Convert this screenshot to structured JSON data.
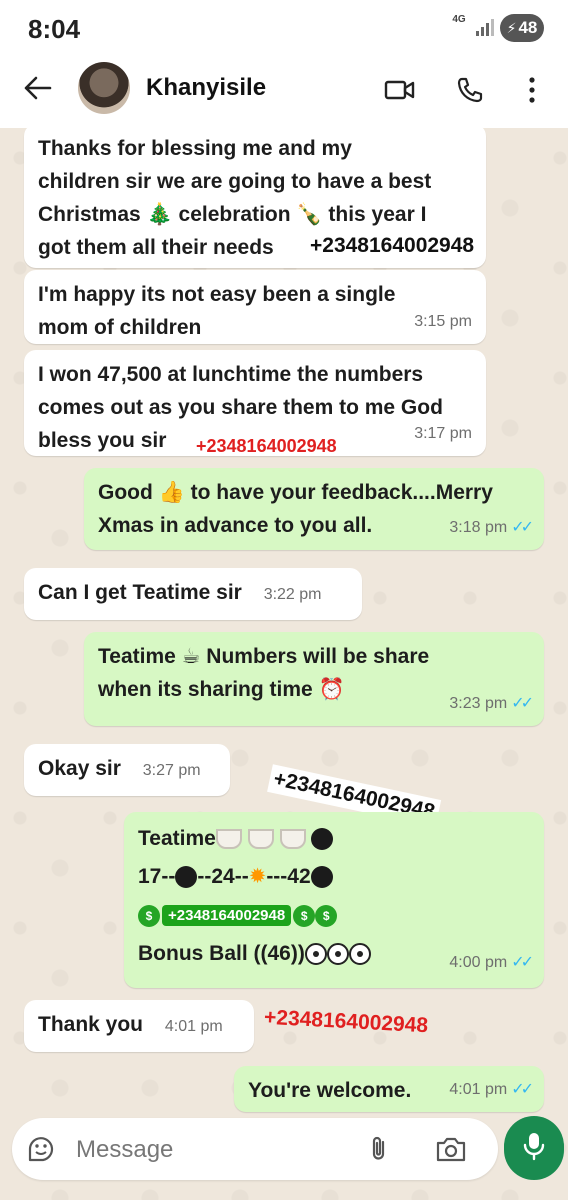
{
  "status_bar": {
    "time": "8:04",
    "network": "4G",
    "battery": "48"
  },
  "header": {
    "contact_name": "Khanyisile"
  },
  "messages": [
    {
      "dir": "in",
      "lines": [
        "Thanks for blessing me and my",
        "children sir we are going to have a best",
        "Christmas 🎄 celebration 🍾 this year I",
        "got them all their needs"
      ]
    },
    {
      "dir": "in",
      "lines": [
        "I'm happy its not easy been a single",
        "mom of children"
      ],
      "time": "3:15 pm"
    },
    {
      "dir": "in",
      "lines": [
        "I won 47,500 at lunchtime the numbers",
        "comes out as you share them to me God",
        "bless you sir"
      ],
      "time": "3:17 pm"
    },
    {
      "dir": "out",
      "lines": [
        "Good 👍 to have your feedback....Merry",
        "Xmas in advance to you all."
      ],
      "time": "3:18 pm"
    },
    {
      "dir": "in",
      "lines": [
        "Can I get Teatime sir"
      ],
      "time": "3:22 pm"
    },
    {
      "dir": "out",
      "lines": [
        "Teatime ☕ Numbers will be share",
        "when its sharing time ⏰"
      ],
      "time": "3:23 pm"
    },
    {
      "dir": "in",
      "lines": [
        "Okay sir"
      ],
      "time": "3:27 pm"
    },
    {
      "dir": "out",
      "lines": [
        "Teatime",
        "17--",
        "--24--",
        "---42",
        "Bonus Ball ((46))"
      ],
      "time": "4:00 pm"
    },
    {
      "dir": "in",
      "lines": [
        "Thank you"
      ],
      "time": "4:01 pm"
    },
    {
      "dir": "out",
      "lines": [
        "You're welcome."
      ],
      "time": "4:01 pm"
    }
  ],
  "overlays": {
    "num1": "+2348164002948",
    "num2": "+2348164002948",
    "num3": "+2348164002948",
    "num4": "+2348164002948",
    "num5": "+2348164002948"
  },
  "input": {
    "placeholder": "Message"
  },
  "colors": {
    "incoming": "#ffffff",
    "outgoing": "#d7f8c4",
    "accent": "#1a8b50",
    "read_ticks": "#34b7f1"
  }
}
